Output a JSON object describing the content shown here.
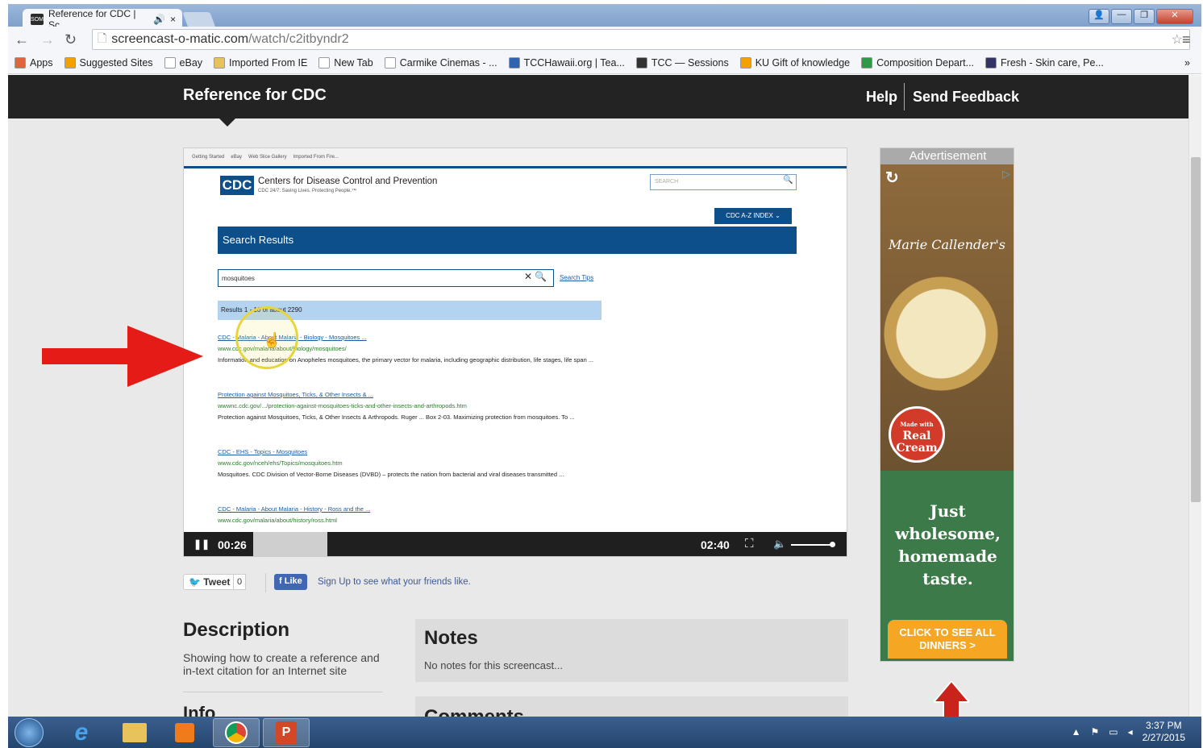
{
  "browser": {
    "tab_title": "Reference for CDC | Sc",
    "tab_close": "×",
    "url_host": "screencast-o-matic.com",
    "url_path": "/watch/c2itbyndr2",
    "bookmarks": [
      {
        "label": "Apps",
        "color": "#e0643c"
      },
      {
        "label": "Suggested Sites",
        "color": "#f4a100"
      },
      {
        "label": "eBay",
        "color": "#ffffff"
      },
      {
        "label": "Imported From IE",
        "color": "#e8c25a"
      },
      {
        "label": "New Tab",
        "color": "#ffffff"
      },
      {
        "label": "Carmike Cinemas - ...",
        "color": "#ffffff"
      },
      {
        "label": "TCCHawaii.org | Tea...",
        "color": "#2f64b3"
      },
      {
        "label": "TCC — Sessions",
        "color": "#333333"
      },
      {
        "label": "KU Gift of knowledge",
        "color": "#f4a100"
      },
      {
        "label": "Composition Depart...",
        "color": "#2f9a45"
      },
      {
        "label": "Fresh - Skin care, Pe...",
        "color": "#333366"
      }
    ],
    "overflow": "»"
  },
  "site": {
    "title": "Reference for CDC",
    "help": "Help",
    "feedback": "Send Feedback"
  },
  "video": {
    "bookmark_items": [
      "Getting Started",
      "eBay",
      "Web Slice Gallery",
      "Imported From Fire..."
    ],
    "cdc_logo": "CDC",
    "cdc_name": "Centers for Disease Control and Prevention",
    "cdc_tagline": "CDC 24/7: Saving Lives. Protecting People.™",
    "search_placeholder": "SEARCH",
    "az_index": "CDC A-Z INDEX ⌄",
    "search_results_heading": "Search Results",
    "query": "mosquitoes",
    "search_tips": "Search Tips",
    "results_count": "Results 1 - 10 of about 2290",
    "results": [
      {
        "title": "CDC - Malaria - About Malaria - Biology - Mosquitoes ...",
        "url": "www.cdc.gov/malaria/about/biology/mosquitoes/",
        "snippet": "Information and education on Anopheles mosquitoes, the primary vector for malaria, including geographic distribution, life stages, life span ..."
      },
      {
        "title": "Protection against Mosquitoes, Ticks, & Other Insects & ...",
        "url": "wwwnc.cdc.gov/.../protection-against-mosquitoes-ticks-and-other-insects-and-arthropods.htm",
        "snippet": "Protection against Mosquitoes, Ticks, & Other Insects & Arthropods. Ruger ... Box 2-03. Maximizing protection from mosquitoes. To ..."
      },
      {
        "title": "CDC - EHS - Topics - Mosquitoes",
        "url": "www.cdc.gov/nceh/ehs/Topics/mosquitoes.htm",
        "snippet": "Mosquitoes. CDC Division of Vector-Borne Diseases (DVBD) – protects the nation from bacterial and viral diseases transmitted ..."
      },
      {
        "title": "CDC - Malaria - About Malaria - History - Ross and the ...",
        "url": "www.cdc.gov/malaria/about/history/ross.html",
        "snippet": ""
      }
    ],
    "current_time": "00:26",
    "duration": "02:40",
    "progress_fraction": 0.162
  },
  "social": {
    "tweet": "Tweet",
    "tweet_count": "0",
    "like": "Like",
    "signup_link": "Sign Up",
    "signup_rest": " to see what your friends like."
  },
  "description": {
    "heading": "Description",
    "text": "Showing how to create a reference and in-text citation for an Internet site"
  },
  "info": {
    "heading": "Info"
  },
  "notes": {
    "heading": "Notes",
    "text": "No notes for this screencast..."
  },
  "comments": {
    "heading": "Comments"
  },
  "ad": {
    "label": "Advertisement",
    "brand": "Marie Callender's",
    "badge_small": "Made with",
    "badge": "Real Cream",
    "tagline": "Just wholesome, homemade taste.",
    "cta": "CLICK TO SEE ALL DINNERS >"
  },
  "taskbar": {
    "time": "3:37 PM",
    "date": "2/27/2015"
  },
  "colors": {
    "site_header": "#232323",
    "cdc_blue": "#0d4f8b",
    "annotation_red": "#e41b17"
  }
}
